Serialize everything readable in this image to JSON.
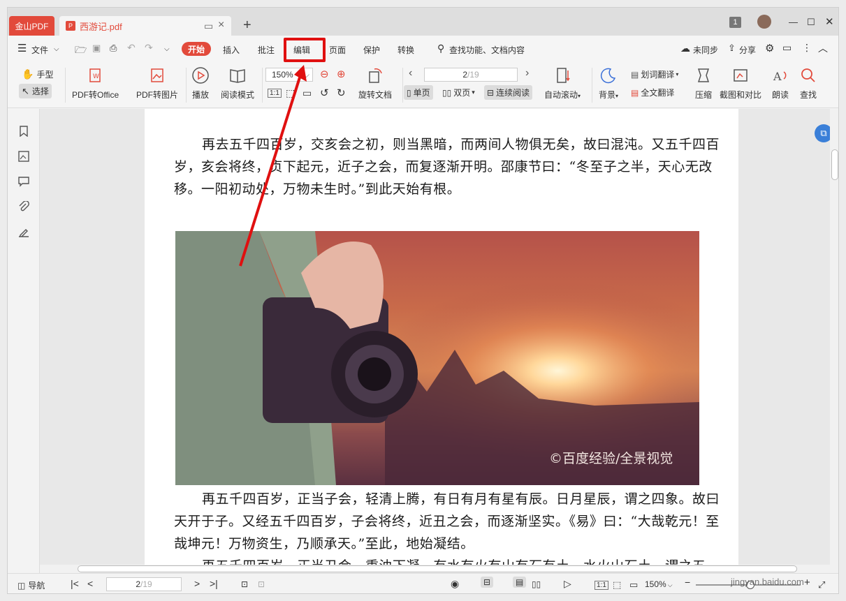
{
  "titlebar": {
    "app_tab": "金山PDF",
    "doc_tab": "西游记.pdf",
    "new_tab": "+",
    "page_badge": "1"
  },
  "menu": {
    "file": "文件",
    "tabs": [
      "开始",
      "插入",
      "批注",
      "编辑",
      "页面",
      "保护",
      "转换"
    ],
    "search": "查找功能、文档内容",
    "sync": "未同步",
    "share": "分享"
  },
  "toolbar": {
    "hand": "手型",
    "select": "选择",
    "pdf_to_office": "PDF转Office",
    "pdf_to_image": "PDF转图片",
    "play": "播放",
    "read_mode": "阅读模式",
    "zoom": "150%",
    "rotate": "旋转文档",
    "page_current": "2",
    "page_total": "/19",
    "single": "单页",
    "double": "双页",
    "continuous": "连续阅读",
    "auto_scroll": "自动滚动",
    "background": "背景",
    "word_translate": "划词翻译",
    "full_translate": "全文翻译",
    "compress": "压缩",
    "crop_compare": "截图和对比",
    "read_aloud": "朗读",
    "find": "查找"
  },
  "document": {
    "para1": "再去五千四百岁，交亥会之初，则当黑暗，而两间人物俱无矣，故曰混沌。又五千四百岁，亥会将终，贞下起元，近子之会，而复逐渐开明。邵康节曰：“冬至子之半，天心无改移。一阳初动处，万物未生时。”到此天始有根。",
    "photo_caption": "©百度经验/全景视觉",
    "para2": "再五千四百岁，正当子会，轻清上腾，有日有月有星有辰。日月星辰，谓之四象。故曰天开于子。又经五千四百岁，子会将终，近丑之会，而逐渐坚实。《易》曰：“大哉乾元！至哉坤元！万物资生，乃顺承天。”至此，地始凝结。",
    "para3": "再五千四百岁，正当丑会，重浊下凝，有水有火有山有石有土。水火山石土，谓之五形。"
  },
  "statusbar": {
    "nav": "导航",
    "page_current": "2",
    "page_total": "/19",
    "zoom": "150%"
  },
  "watermark": "jingyan.baidu.com",
  "colors": {
    "accent": "#e24a3b",
    "highlight": "#e01010"
  }
}
